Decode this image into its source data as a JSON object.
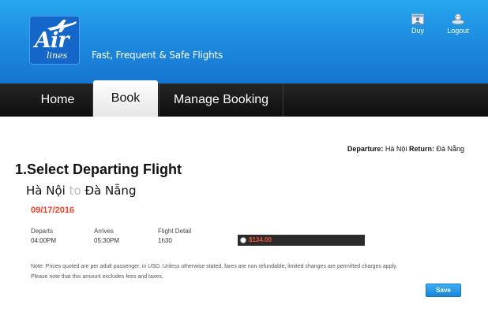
{
  "header": {
    "logo": {
      "word_main": "Air",
      "word_sub": "lines"
    },
    "tagline": "Fast, Frequent & Safe Flights",
    "user_label": "Duy",
    "logout_label": "Logout"
  },
  "nav": {
    "tabs": [
      {
        "label": "Home",
        "active": false
      },
      {
        "label": "Book",
        "active": true
      },
      {
        "label": "Manage Booking",
        "active": false
      }
    ]
  },
  "route_summary": {
    "departure_label": "Departure:",
    "departure_value": "Hà Nội",
    "return_label": "Return:",
    "return_value": "Đà Nẵng"
  },
  "section": {
    "title": "1.Select Departing Flight",
    "origin": "Hà Nội",
    "connector": "to",
    "destination": "Đà Nẵng",
    "date": "09/17/2016"
  },
  "flight": {
    "columns": [
      "Departs",
      "Arrives",
      "Flight Detail"
    ],
    "departs": "04:00PM",
    "arrives": "05:30PM",
    "detail": "1h30",
    "price": "$134.00"
  },
  "notes": {
    "line1": "Note: Prices quoted are per adult passenger, in USD. Unless otherwise stated, fares are non refundable, limited changes are permitted charges apply.",
    "line2": "Please note that this amount excludes fees and taxes."
  },
  "actions": {
    "save_label": "Save"
  },
  "colors": {
    "header_blue": "#1c88de",
    "nav_dark": "#111111",
    "date_red": "#e8452b",
    "price_red": "#f0503a",
    "save_blue": "#1a86d6"
  },
  "icons": {
    "logo": "airplane-icon",
    "user": "user-card-icon",
    "logout": "logout-icon",
    "fare": "radio-icon"
  }
}
